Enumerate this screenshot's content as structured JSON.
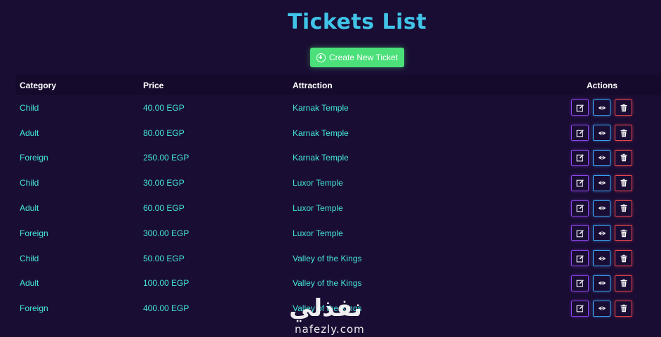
{
  "page": {
    "title": "Tickets List",
    "create_button_label": "Create New Ticket"
  },
  "table": {
    "headers": {
      "category": "Category",
      "price": "Price",
      "attraction": "Attraction",
      "actions": "Actions"
    },
    "rows": [
      {
        "category": "Child",
        "price": "40.00 EGP",
        "attraction": "Karnak Temple"
      },
      {
        "category": "Adult",
        "price": "80.00 EGP",
        "attraction": "Karnak Temple"
      },
      {
        "category": "Foreign",
        "price": "250.00 EGP",
        "attraction": "Karnak Temple"
      },
      {
        "category": "Child",
        "price": "30.00 EGP",
        "attraction": "Luxor Temple"
      },
      {
        "category": "Adult",
        "price": "60.00 EGP",
        "attraction": "Luxor Temple"
      },
      {
        "category": "Foreign",
        "price": "300.00 EGP",
        "attraction": "Luxor Temple"
      },
      {
        "category": "Child",
        "price": "50.00 EGP",
        "attraction": "Valley of the Kings"
      },
      {
        "category": "Adult",
        "price": "100.00 EGP",
        "attraction": "Valley of the Kings"
      },
      {
        "category": "Foreign",
        "price": "400.00 EGP",
        "attraction": "Valley of the Kings"
      }
    ]
  },
  "watermark": {
    "arabic": "نفذلي",
    "latin": "nafezly.com"
  },
  "colors": {
    "background": "#1a0d33",
    "title": "#40c4e8",
    "create_button": "#4be07a",
    "cell_text": "#44e6d9",
    "edit_border": "#8a46e8",
    "view_border": "#3a9ff0",
    "delete_border": "#e8464e"
  },
  "icons": {
    "create": "plus-circle-icon",
    "edit": "edit-icon",
    "view": "eye-icon",
    "delete": "trash-icon"
  }
}
